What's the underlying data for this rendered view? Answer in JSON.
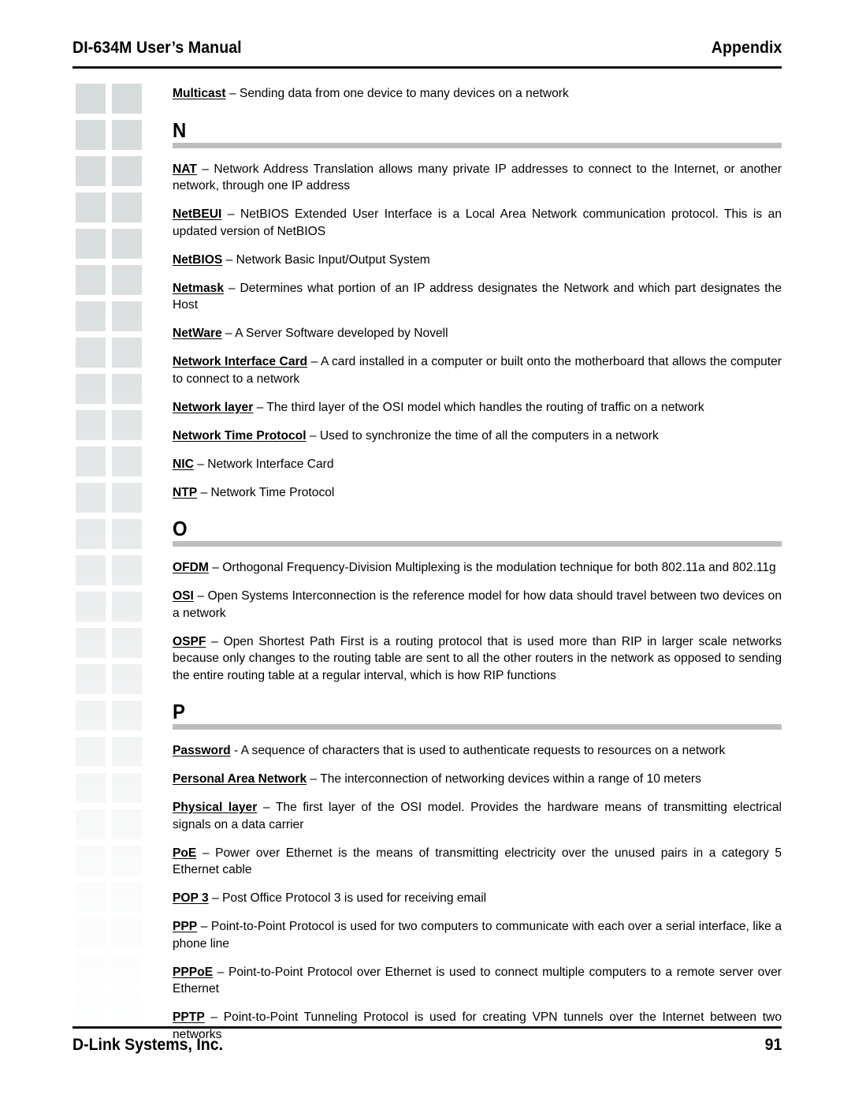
{
  "header": {
    "manual_title": "DI-634M User’s Manual",
    "section_label": "Appendix"
  },
  "footer": {
    "company": "D-Link Systems, Inc.",
    "page_number": "91"
  },
  "colors": {
    "rule": "#111111",
    "section_bar": "#bdbdbd",
    "decorative_square": "#d6dbdc",
    "text": "#000000",
    "page_background": "#ffffff"
  },
  "decorative": {
    "name": "left-margin-square-grid",
    "columns": 2,
    "rows": 26,
    "square_size_px": 38
  },
  "content": {
    "lead_entry": {
      "term": "Multicast",
      "definition": " – Sending data from one device to many devices on a network"
    },
    "sections": [
      {
        "letter": "N",
        "entries": [
          {
            "term": "NAT",
            "definition": " – Network Address Translation allows many private IP addresses to connect to the Internet, or another network, through one IP address"
          },
          {
            "term": "NetBEUI",
            "definition": " – NetBIOS Extended User Interface is a Local Area Network communication protocol.  This is an updated version of NetBIOS"
          },
          {
            "term": "NetBIOS",
            "definition": " – Network Basic Input/Output System"
          },
          {
            "term": "Netmask",
            "definition": " – Determines what portion of an IP address designates the Network and which part designates the Host"
          },
          {
            "term": "NetWare",
            "definition": " – A Server Software developed by Novell"
          },
          {
            "term": "Network Interface Card",
            "definition": " – A card installed in a computer or built onto the motherboard that allows the computer to connect to a network"
          },
          {
            "term": "Network layer",
            "definition": " – The third layer of the OSI model which handles the routing of traffic on a network"
          },
          {
            "term": "Network Time Protocol",
            "definition": " – Used to synchronize the time of all the computers in a network"
          },
          {
            "term": "NIC",
            "definition": " – Network Interface Card"
          },
          {
            "term": "NTP",
            "definition": " – Network Time Protocol"
          }
        ]
      },
      {
        "letter": "O",
        "entries": [
          {
            "term": "OFDM",
            "definition": " – Orthogonal Frequency-Division Multiplexing is the modulation technique for both 802.11a and 802.11g"
          },
          {
            "term": "OSI",
            "definition": " – Open Systems Interconnection is the reference model for how data should travel between two devices on a network"
          },
          {
            "term": "OSPF",
            "definition": " – Open Shortest Path First is a routing protocol that is used more than RIP in larger scale networks because only changes to the routing table are sent to all the other routers in the network as opposed to sending the entire routing table at a regular interval, which is how RIP functions"
          }
        ]
      },
      {
        "letter": "P",
        "entries": [
          {
            "term": "Password",
            "definition": " -  A sequence of characters that is used to authenticate requests to resources on a network"
          },
          {
            "term": "Personal Area Network",
            "definition": " – The interconnection of networking devices within a range of 10 meters"
          },
          {
            "term": "Physical layer",
            "definition": " – The first layer of the OSI model.  Provides the hardware means of transmitting electrical signals on a data carrier"
          },
          {
            "term": "PoE",
            "definition": " – Power over Ethernet is the means of transmitting electricity over the unused pairs in a category 5 Ethernet cable"
          },
          {
            "term": "POP 3",
            "definition": " – Post Office Protocol 3 is used for receiving email"
          },
          {
            "term": "PPP",
            "definition": " – Point-to-Point Protocol is used for two computers to communicate with each over a serial interface, like a phone line"
          },
          {
            "term": "PPPoE",
            "definition": " – Point-to-Point Protocol over Ethernet is used to connect multiple computers to a remote server over Ethernet"
          },
          {
            "term": "PPTP",
            "definition": " – Point-to-Point Tunneling Protocol is used for creating VPN tunnels over the Internet between two networks"
          }
        ]
      }
    ]
  }
}
